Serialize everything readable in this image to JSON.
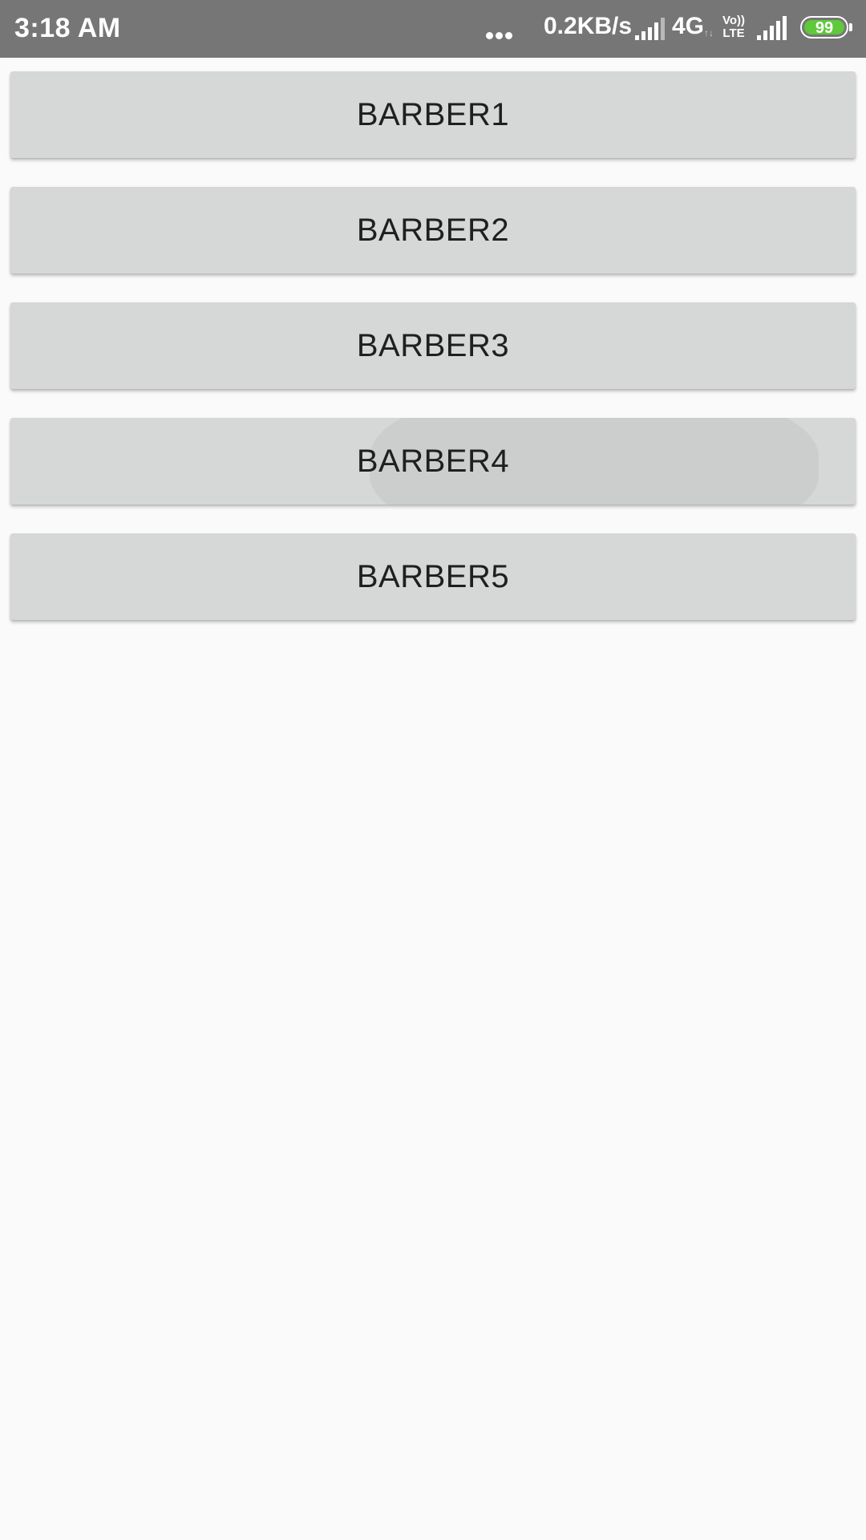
{
  "status_bar": {
    "time": "3:18 AM",
    "net_speed": "0.2KB/s",
    "network_type": "4G",
    "data_arrows": "↑↓",
    "volte_top": "Vo))",
    "volte_bottom": "LTE",
    "battery_level": "99",
    "battery_color": "#5fc93a",
    "icons": [
      "more-dots-icon",
      "signal-icon",
      "signal-icon",
      "battery-icon"
    ]
  },
  "barbers": [
    {
      "label": "BARBER1"
    },
    {
      "label": "BARBER2"
    },
    {
      "label": "BARBER3"
    },
    {
      "label": "BARBER4",
      "pressed": true
    },
    {
      "label": "BARBER5"
    }
  ]
}
